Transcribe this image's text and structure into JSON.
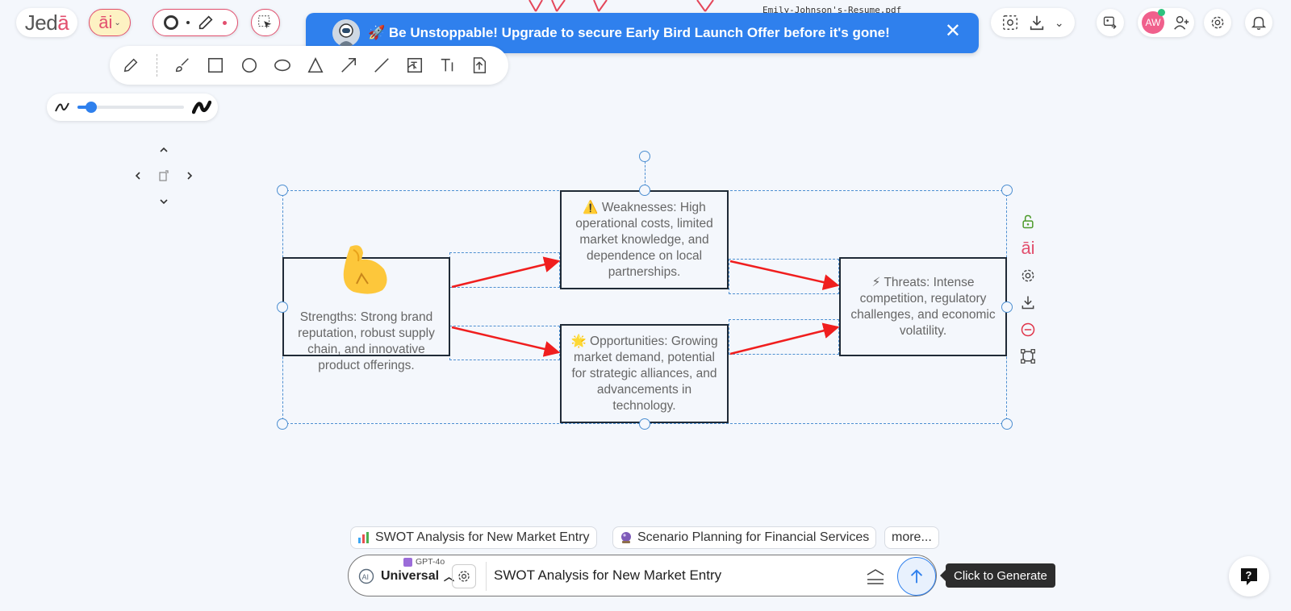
{
  "app": {
    "logo_main": "Jed",
    "logo_accent": "ā"
  },
  "header": {
    "file_name": "Emily-Johnson's-Resume.pdf",
    "avatar_initials": "AW"
  },
  "banner": {
    "text": "🚀 Be Unstoppable! Upgrade to secure Early Bird Launch Offer before it's gone!"
  },
  "ai_button": {
    "label": "āi"
  },
  "diagram": {
    "strengths": "Strengths: Strong brand reputation, robust supply chain, and innovative product offerings.",
    "weaknesses": "⚠️ Weaknesses: High operational costs, limited market knowledge, and dependence on local partnerships.",
    "opportunities": "🌟 Opportunities: Growing market demand, potential for strategic alliances, and advancements in technology.",
    "threats": "⚡ Threats: Intense competition, regulatory challenges, and economic volatility."
  },
  "side_tools": {
    "ai_label": "āi"
  },
  "suggestions": [
    {
      "label": "SWOT Analysis for New Market Entry"
    },
    {
      "label": "Scenario Planning for Financial Services"
    },
    {
      "label": "more..."
    }
  ],
  "prompt": {
    "model": "GPT-4o",
    "mode": "Universal",
    "value": "SWOT Analysis for New Market Entry"
  },
  "tooltip": {
    "text": "Click to Generate"
  },
  "colors": {
    "accent": "#e24f6e",
    "banner": "#2f80ed",
    "arrow": "#f01e1e",
    "border": "#1f2a36",
    "handle": "#4d8fd1"
  }
}
